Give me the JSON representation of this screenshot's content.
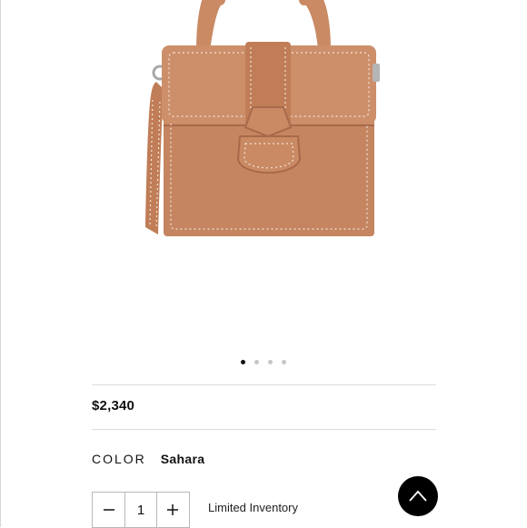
{
  "product": {
    "image_icon": "leather-handbag-image",
    "carousel": {
      "count": 4,
      "active_index": 0
    },
    "price": "$2,340",
    "color": {
      "label": "COLOR",
      "value": "Sahara"
    },
    "quantity": {
      "decrement_icon": "minus-icon",
      "value": "1",
      "increment_icon": "plus-icon"
    },
    "inventory_note": "Limited Inventory"
  },
  "scroll_top": {
    "icon": "chevron-up-icon"
  },
  "colors": {
    "leather": "#c98a64",
    "leather_dark": "#a8694a",
    "stitch": "#f3e4d8",
    "divider": "#dcdcdc",
    "dot_active": "#111111",
    "dot_inactive": "#c7c7c7"
  }
}
